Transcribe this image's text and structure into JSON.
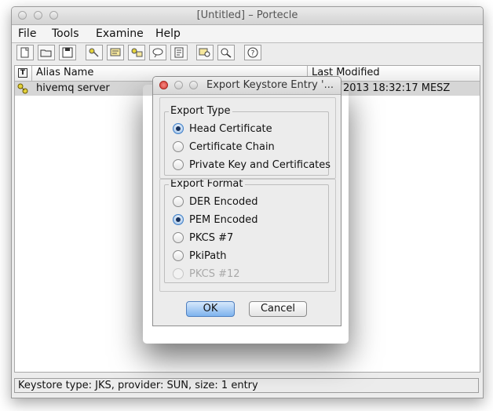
{
  "window": {
    "title": "[Untitled] – Portecle"
  },
  "menubar": [
    "File",
    "Tools",
    "Examine",
    "Help"
  ],
  "toolbar": {
    "icons": [
      "new-keystore-icon",
      "open-keystore-icon",
      "save-keystore-icon",
      "generate-keypair-icon",
      "import-trusted-cert-icon",
      "import-keypair-icon",
      "set-password-icon",
      "keystore-report-icon",
      "examine-cert-icon",
      "examine-csr-icon",
      "help-icon"
    ]
  },
  "table": {
    "columns": [
      "Alias Name",
      "Last Modified"
    ],
    "header_type_icon": "T",
    "rows": [
      {
        "alias": "hivemq server",
        "modified": "2013 18:32:17 MESZ",
        "type_icon": "keypair-icon"
      }
    ]
  },
  "status": "Keystore type: JKS, provider: SUN, size: 1 entry",
  "dialog": {
    "title": "Export Keystore Entry '...",
    "export_type": {
      "label": "Export Type",
      "options": [
        "Head Certificate",
        "Certificate Chain",
        "Private Key and Certificates"
      ],
      "selected": "Head Certificate"
    },
    "export_format": {
      "label": "Export Format",
      "options": [
        "DER Encoded",
        "PEM Encoded",
        "PKCS #7",
        "PkiPath",
        "PKCS #12"
      ],
      "selected": "PEM Encoded",
      "disabled": [
        "PKCS #12"
      ]
    },
    "ok": "OK",
    "cancel": "Cancel"
  },
  "colors": {
    "selection": "#d6d6d6",
    "accent": "#3f7fc8",
    "close": "#e0443e"
  }
}
